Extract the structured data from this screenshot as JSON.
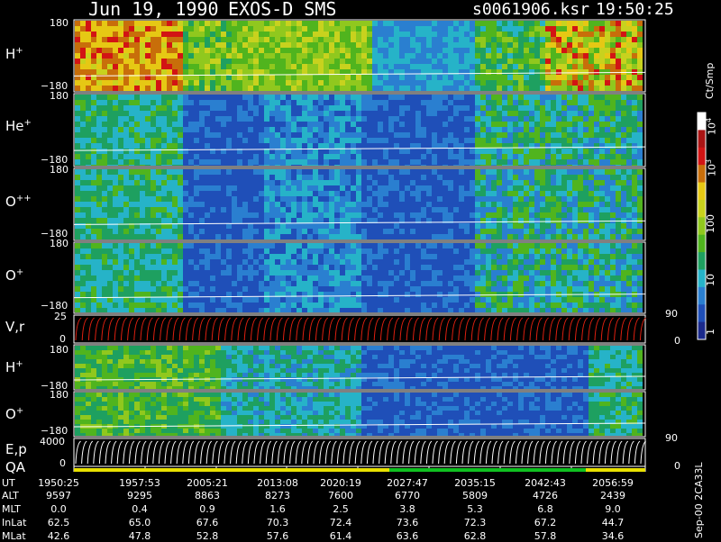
{
  "title": {
    "date": "Jun 19, 1990",
    "instrument": "EXOS-D SMS",
    "file": "s0061906.ksr",
    "time": "19:50:25"
  },
  "panels": [
    {
      "ion": "H",
      "charge": "+",
      "ymax": "180",
      "ymin": "−180"
    },
    {
      "ion": "He",
      "charge": "+",
      "ymax": "180",
      "ymin": "−180"
    },
    {
      "ion": "O",
      "charge": "++",
      "ymax": "180",
      "ymin": "−180"
    },
    {
      "ion": "O",
      "charge": "+",
      "ymax": "180",
      "ymin": "−180"
    },
    {
      "label": "V,r",
      "ymax": "25",
      "ymin": "0",
      "right_top": "90",
      "right_bottom": "0"
    },
    {
      "ion": "H",
      "charge": "+",
      "ymax": "180",
      "ymin": "−180"
    },
    {
      "ion": "O",
      "charge": "+",
      "ymax": "180",
      "ymin": "−180"
    },
    {
      "label": "E,p",
      "ymax": "4000",
      "ymin": "0",
      "right_top": "90",
      "right_bottom": "0"
    }
  ],
  "qa_label": "QA",
  "colorbar": {
    "unit": "Ct/Smp",
    "ticks": [
      {
        "base": "10",
        "exp": "4"
      },
      {
        "base": "10",
        "exp": "3"
      },
      {
        "text": "100"
      },
      {
        "text": "10"
      },
      {
        "text": "1"
      }
    ]
  },
  "side_note": "Sep-00  2CA33L",
  "colors": {
    "background": "#000000",
    "velocity_trace": "#e02010",
    "qa_yellow": "#e8e000",
    "qa_green": "#10c020",
    "colormap": [
      "#1b2a8c",
      "#1f4fb8",
      "#2a7fd0",
      "#26b3c8",
      "#1ea060",
      "#50b41e",
      "#90c81e",
      "#c8d21e",
      "#e6c814",
      "#c86e0a",
      "#d21414",
      "#aa1414",
      "#ffffff"
    ]
  },
  "table": {
    "rows": [
      {
        "name": "UT",
        "values": [
          "1950:25",
          "1957:53",
          "2005:21",
          "2013:08",
          "2020:19",
          "2027:47",
          "2035:15",
          "2042:43",
          "2056:59"
        ]
      },
      {
        "name": "ALT",
        "values": [
          "9597",
          "9295",
          "8863",
          "8273",
          "7600",
          "6770",
          "5809",
          "4726",
          "2439"
        ]
      },
      {
        "name": "MLT",
        "values": [
          "0.0",
          "0.4",
          "0.9",
          "1.6",
          "2.5",
          "3.8",
          "5.3",
          "6.8",
          "9.0"
        ]
      },
      {
        "name": "InLat",
        "values": [
          "62.5",
          "65.0",
          "67.6",
          "70.3",
          "72.4",
          "73.6",
          "72.3",
          "67.2",
          "44.7"
        ]
      },
      {
        "name": "MLat",
        "values": [
          "42.6",
          "47.8",
          "52.8",
          "57.6",
          "61.4",
          "63.6",
          "62.8",
          "57.8",
          "34.6"
        ]
      }
    ]
  },
  "chart_data": {
    "type": "heatmap",
    "time_axis": [
      "1950:25",
      "1957:53",
      "2005:21",
      "2013:08",
      "2020:19",
      "2027:47",
      "2035:15",
      "2042:43",
      "2056:59"
    ],
    "panel_ylim": {
      "pitch_angle_panels": [
        -180,
        180
      ],
      "V,r": [
        0,
        25
      ],
      "E,p": [
        0,
        4000
      ]
    },
    "color_scale": {
      "unit": "Ct/Smp",
      "type": "log",
      "range": [
        1,
        10000
      ]
    }
  }
}
